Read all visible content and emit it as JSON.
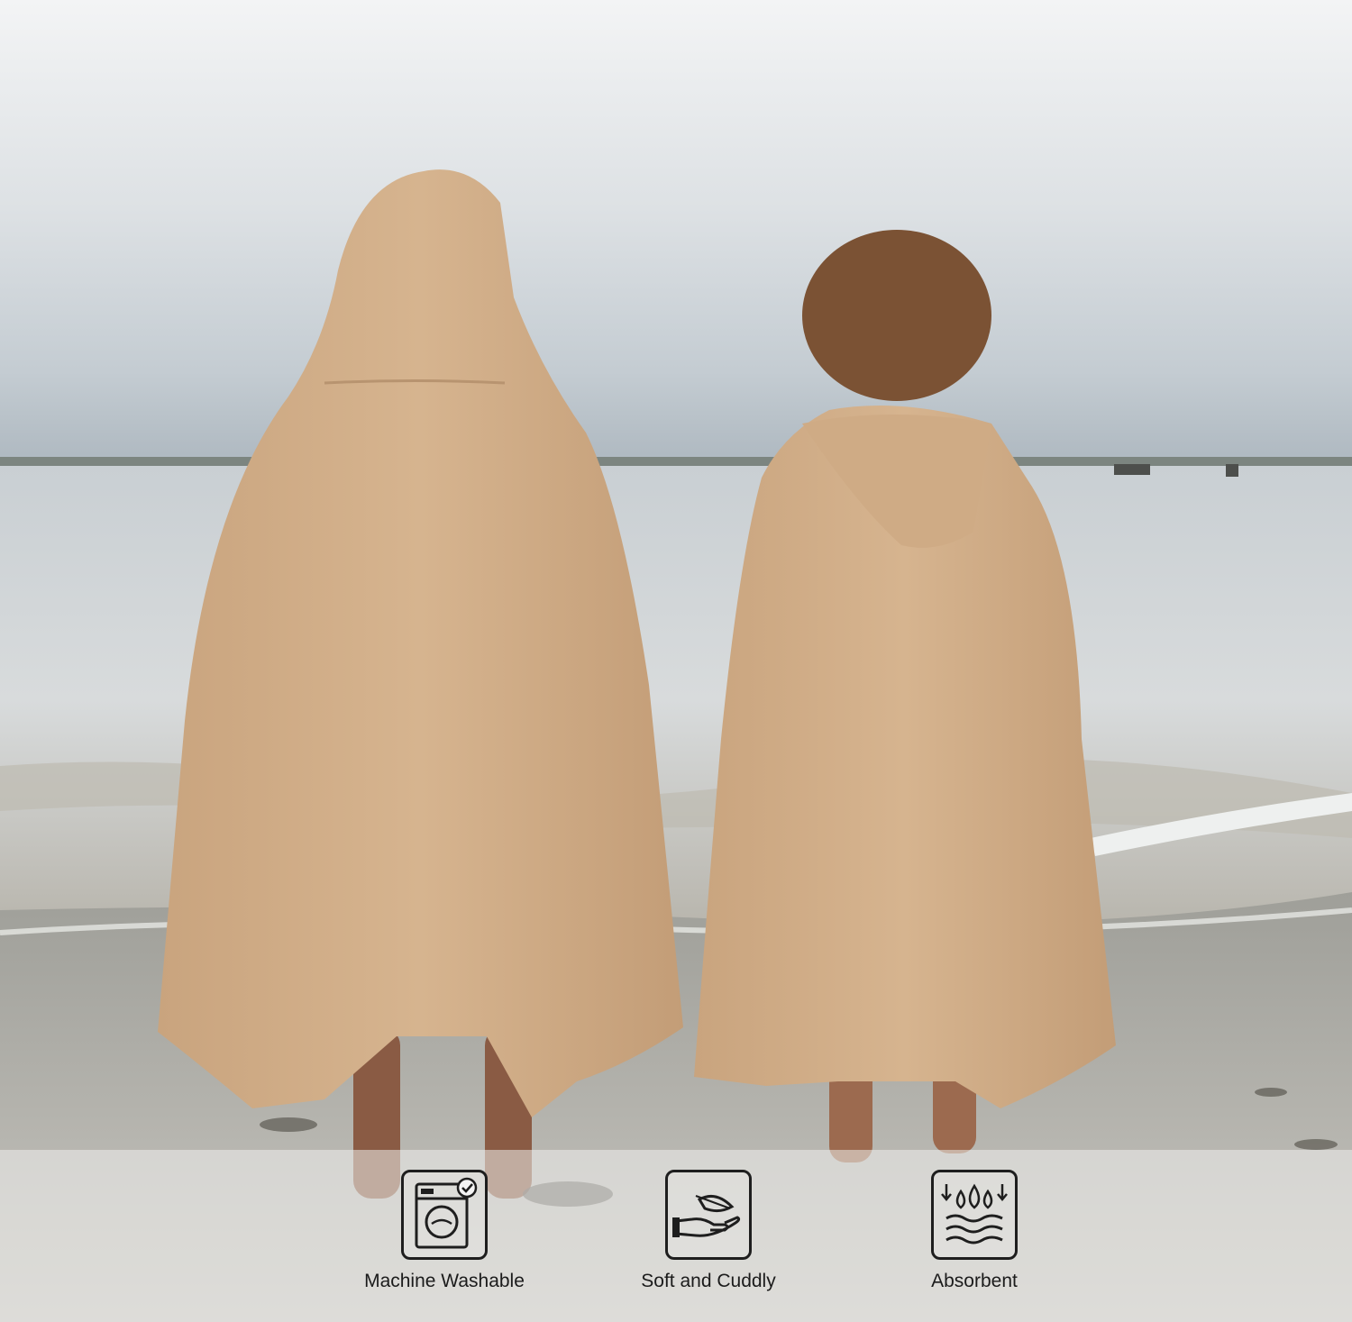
{
  "photo": {
    "subject": "kids-hooded-towels-beach",
    "towel_color": "#d2b08b",
    "sky_color": "#e3e7ea",
    "water_color": "#c9ced1",
    "sand_color": "#b9b8b3"
  },
  "features": [
    {
      "icon": "washing-machine-icon",
      "label": "Machine Washable"
    },
    {
      "icon": "feather-hand-icon",
      "label": "Soft and Cuddly"
    },
    {
      "icon": "water-drops-icon",
      "label": "Absorbent"
    }
  ]
}
